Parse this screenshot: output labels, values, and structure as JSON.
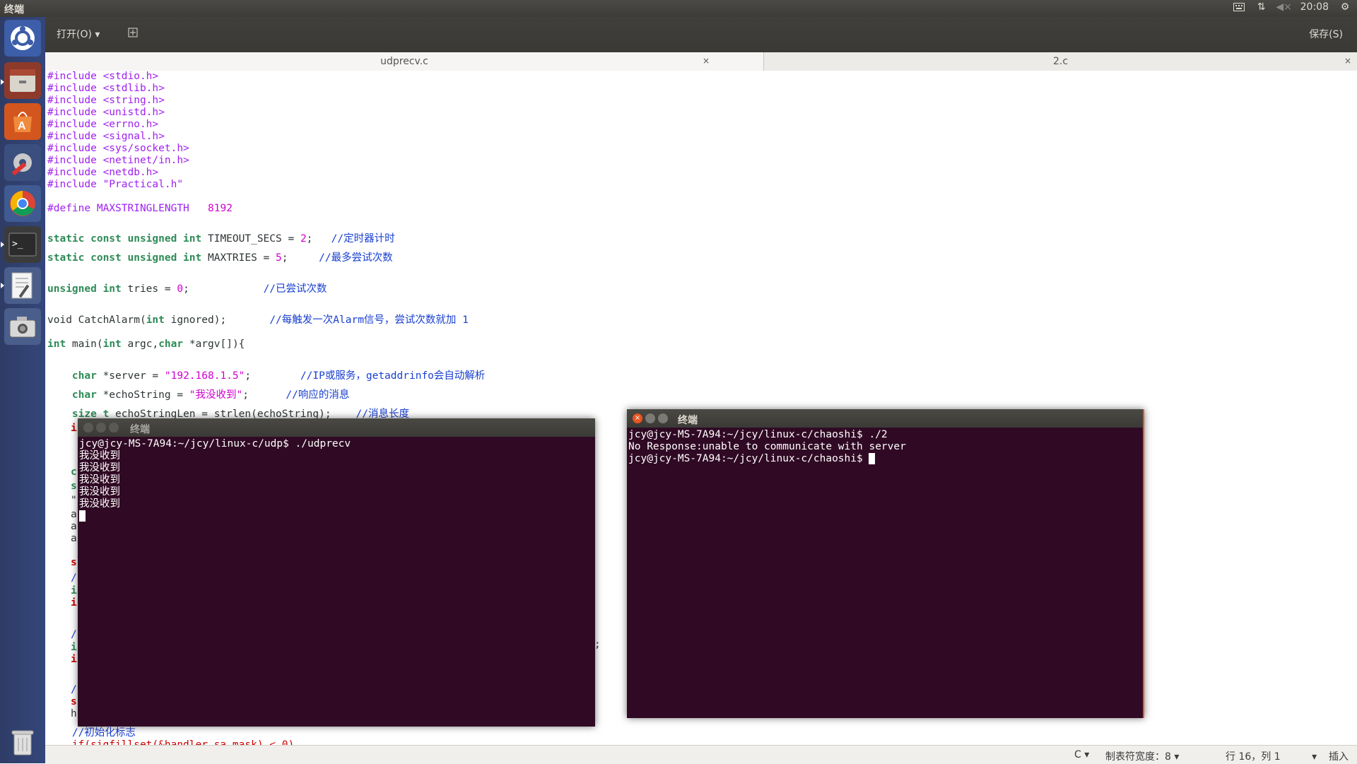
{
  "top_panel": {
    "title": "终端",
    "time": "20:08",
    "icons": [
      "keyboard-icon",
      "network-icon",
      "volume-muted-icon",
      "gear-icon"
    ]
  },
  "launcher": {
    "items": [
      "ubuntu-dash",
      "files",
      "software-center",
      "system-settings",
      "chrome",
      "terminal",
      "text-editor",
      "screenshot",
      "trash"
    ]
  },
  "gedit": {
    "open_label": "打开(O)",
    "save_label": "保存(S)",
    "tabs": [
      {
        "label": "udprecv.c"
      },
      {
        "label": "2.c"
      }
    ],
    "code": {
      "includes": [
        "#include <stdio.h>",
        "#include <stdlib.h>",
        "#include <string.h>",
        "#include <unistd.h>",
        "#include <errno.h>",
        "#include <signal.h>",
        "#include <sys/socket.h>",
        "#include <netinet/in.h>",
        "#include <netdb.h>",
        "#include \"Practical.h\""
      ],
      "define_kw": "#define MAXSTRINGLENGTH",
      "define_val": "8192",
      "l1_kw": "static const unsigned int",
      "l1_name": " TIMEOUT_SECS = ",
      "l1_num": "2",
      "l1_end": ";",
      "l1_cm": "//定时器计时",
      "l2_kw": "static const unsigned int",
      "l2_name": " MAXTRIES = ",
      "l2_num": "5",
      "l2_end": ";",
      "l2_cm": "//最多尝试次数",
      "l3_kw": "unsigned int",
      "l3_name": " tries = ",
      "l3_num": "0",
      "l3_end": ";",
      "l3_cm": "//已尝试次数",
      "l4_a": "void CatchAlarm(",
      "l4_kw": "int",
      "l4_b": " ignored);",
      "l4_cm": "//每触发一次Alarm信号，尝试次数就加 1",
      "l5_kw1": "int",
      "l5_a": " main(",
      "l5_kw2": "int",
      "l5_b": " argc,",
      "l5_kw3": "char",
      "l5_c": " *argv[]){",
      "l6_kw": "char",
      "l6_a": " *server = ",
      "l6_str": "\"192.168.1.5\"",
      "l6_end": ";",
      "l6_cm": "//IP或服务，getaddrinfo会自动解析",
      "l7_kw": "char",
      "l7_a": " *echoString = ",
      "l7_str": "\"我没收到\"",
      "l7_end": ";",
      "l7_cm": "//响应的消息",
      "l8_kw": "size_t",
      "l8_a": " echoStringLen = strlen(echoString);",
      "l8_cm": "//消息长度",
      "l9_cm": "//初始化标志",
      "l10": "if(sigfillset(&handler.sa_mask) < 0)",
      "stray_semicolon": ";"
    }
  },
  "statusbar": {
    "lang": "C",
    "tab_width": "制表符宽度：8",
    "position": "行 16，列 1",
    "mode": "插入"
  },
  "terminal_left": {
    "title": "终端",
    "lines": [
      "jcy@jcy-MS-7A94:~/jcy/linux-c/udp$ ./udprecv",
      "我没收到",
      "我没收到",
      "我没收到",
      "我没收到",
      "我没收到"
    ]
  },
  "terminal_right": {
    "title": "终端",
    "lines": [
      "jcy@jcy-MS-7A94:~/jcy/linux-c/chaoshi$ ./2",
      "No Response:unable to communicate with server",
      "jcy@jcy-MS-7A94:~/jcy/linux-c/chaoshi$ "
    ]
  },
  "colors": {
    "terminal_bg": "#300a24",
    "launcher_bg": "#2f3f6e",
    "panel_bg": "#3c3b37",
    "comment": "#1a40d0",
    "keyword": "#2e8b57",
    "preprocessor": "#a020f0"
  }
}
